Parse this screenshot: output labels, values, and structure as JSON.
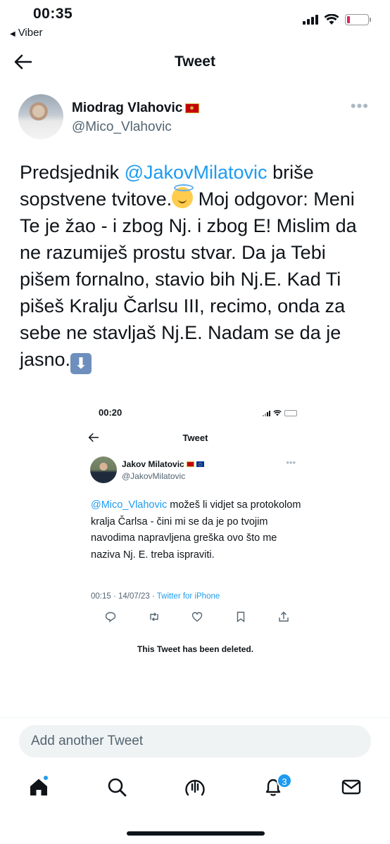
{
  "status_bar": {
    "time": "00:35",
    "back_app": "Viber",
    "battery_color": "#e0245e"
  },
  "header": {
    "title": "Tweet"
  },
  "author": {
    "name": "Miodrag Vlahovic",
    "handle": "@Mico_Vlahovic",
    "flag_icon": "montenegro-flag"
  },
  "tweet": {
    "part1": "Predsjednik ",
    "mention": "@JakovMilatovic",
    "part2": " briše sopstvene tvitove.",
    "part3": " Moj odgovor: Meni Te je žao - i zbog Nj. i zbog E! Mislim da ne razumiješ prostu stvar. Da ja Tebi pišem fornalno, stavio bih Nj.E. Kad Ti pišeš Kralju Čarlsu III, recimo, onda za sebe ne stavljaš Nj.E. Nadam se da je jasno.",
    "emoji1": "smiling-face-with-halo",
    "emoji2": "⬇"
  },
  "embedded": {
    "status_time": "00:20",
    "title": "Tweet",
    "author_name": "Jakov Milatovic",
    "author_handle": "@JakovMilatovic",
    "mention": "@Mico_Vlahovic",
    "text": " možeš li vidjet sa protokolom kralja Čarlsa - čini mi se da je po tvojim navodima napravljena greška ovo što me naziva Nj. E. treba ispraviti.",
    "meta_time": "00:15 · 14/07/23 · ",
    "meta_source": "Twitter for iPhone",
    "deleted_notice": "This Tweet has been deleted."
  },
  "reply": {
    "placeholder": "Add another Tweet"
  },
  "nav": {
    "items": [
      "home-icon",
      "search-icon",
      "spaces-icon",
      "notifications-icon",
      "messages-icon"
    ],
    "notifications_badge": "3"
  },
  "colors": {
    "accent": "#1d9bf0",
    "text": "#0f1419",
    "secondary": "#536471"
  }
}
